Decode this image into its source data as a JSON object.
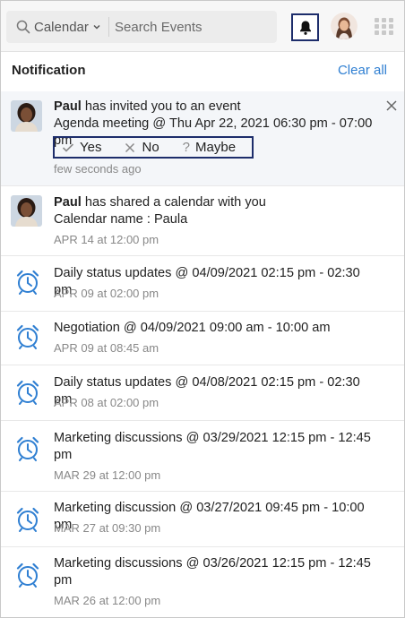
{
  "topbar": {
    "calendar_select": "Calendar",
    "search_placeholder": "Search Events"
  },
  "header": {
    "title": "Notification",
    "clear_all": "Clear all"
  },
  "invite": {
    "name": "Paul",
    "message": " has invited you to an event",
    "detail": "Agenda meeting @ Thu Apr 22, 2021 06:30 pm - 07:00 pm",
    "rsvp": {
      "yes": "Yes",
      "no": "No",
      "maybe": "Maybe"
    },
    "time": "few seconds ago"
  },
  "share": {
    "name": "Paul",
    "message": " has shared a calendar with you",
    "detail": "Calendar name : Paula",
    "time": "APR 14 at 12:00 pm"
  },
  "reminders": [
    {
      "text": "Daily status updates @ 04/09/2021 02:15 pm - 02:30 pm",
      "time": "APR 09 at 02:00 pm"
    },
    {
      "text": "Negotiation @ 04/09/2021 09:00 am - 10:00 am",
      "time": "APR 09 at 08:45 am"
    },
    {
      "text": "Daily status updates @ 04/08/2021 02:15 pm - 02:30 pm",
      "time": "APR 08 at 02:00 pm"
    },
    {
      "text": "Marketing discussions @ 03/29/2021 12:15 pm - 12:45 pm",
      "time": "MAR 29 at 12:00 pm"
    },
    {
      "text": "Marketing discussion @ 03/27/2021 09:45 pm - 10:00 pm",
      "time": "MAR 27 at 09:30 pm"
    },
    {
      "text": "Marketing discussions @ 03/26/2021 12:15 pm - 12:45 pm",
      "time": "MAR 26 at 12:00 pm"
    }
  ],
  "colors": {
    "accent": "#2f7fd2",
    "focus_border": "#1d2d6b",
    "alarm_icon": "#2f7fd2"
  }
}
